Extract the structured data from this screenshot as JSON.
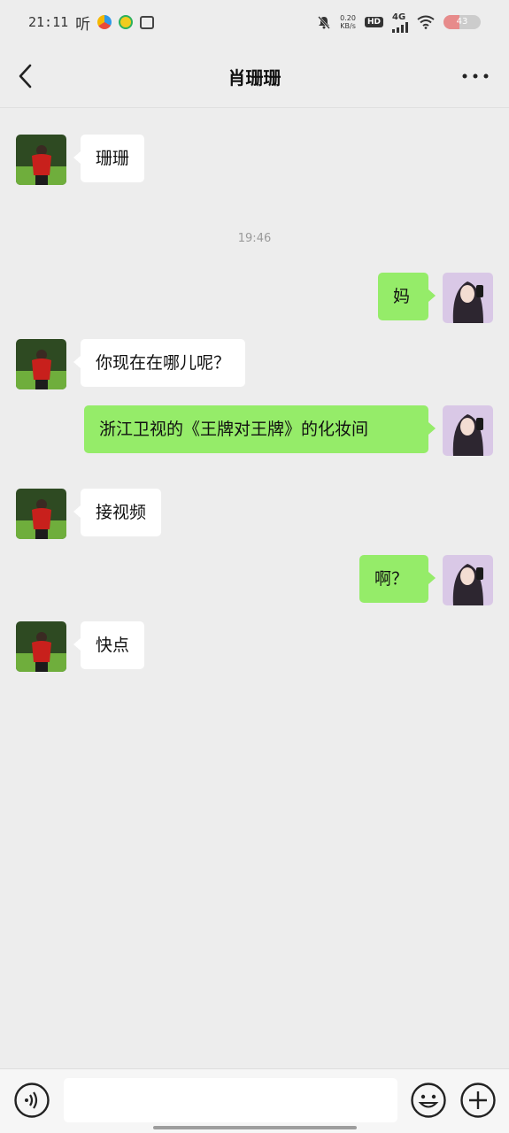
{
  "status_bar": {
    "time": "21:11",
    "app_label": "听",
    "net_speed_value": "0.20",
    "net_speed_unit": "KB/s",
    "hd_label": "HD",
    "network_label": "4G",
    "battery_level": "43"
  },
  "header": {
    "title": "肖珊珊"
  },
  "messages": [
    {
      "side": "in",
      "text": "珊珊"
    },
    {
      "side": "out",
      "text": "妈"
    },
    {
      "side": "in",
      "text": "你现在在哪儿呢？"
    },
    {
      "side": "out",
      "text": "浙江卫视的《王牌对王牌》的化妆间"
    },
    {
      "side": "in",
      "text": "接视频"
    },
    {
      "side": "out",
      "text": "啊？"
    },
    {
      "side": "in",
      "text": "快点"
    }
  ],
  "timestamp": "19:46",
  "colors": {
    "incoming_bubble": "#ffffff",
    "outgoing_bubble": "#95ec69",
    "background": "#ededed"
  },
  "icons": {
    "back": "chevron-left-icon",
    "more": "more-dots-icon",
    "voice": "voice-icon",
    "emoji": "emoji-icon",
    "plus": "plus-icon"
  },
  "input": {
    "value": ""
  }
}
